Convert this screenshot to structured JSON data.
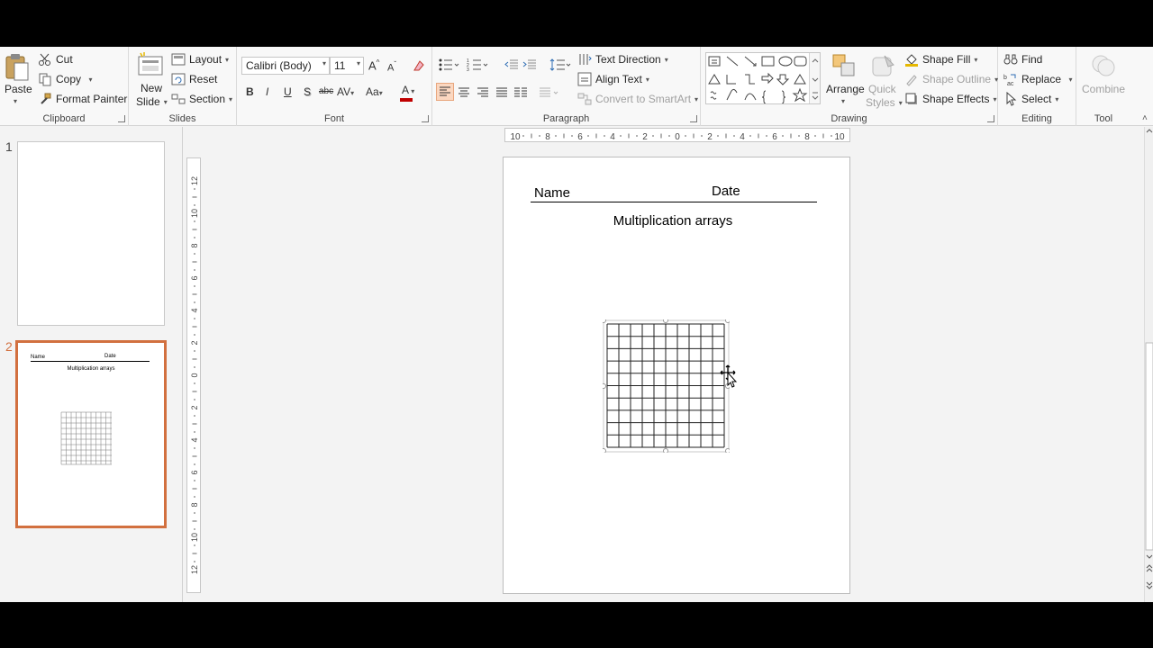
{
  "ribbon": {
    "clipboard": {
      "label": "Clipboard",
      "paste": "Paste",
      "cut": "Cut",
      "copy": "Copy",
      "format_painter": "Format Painter"
    },
    "slides": {
      "label": "Slides",
      "new_slide_line1": "New",
      "new_slide_line2": "Slide",
      "layout": "Layout",
      "reset": "Reset",
      "section": "Section"
    },
    "font": {
      "label": "Font",
      "family": "Calibri (Body)",
      "size": "11",
      "bold": "B",
      "italic": "I",
      "underline": "U",
      "shadow": "S",
      "strike": "abc",
      "spacing": "AV",
      "case": "Aa",
      "grow": "A",
      "shrink": "A",
      "color_letter": "A"
    },
    "paragraph": {
      "label": "Paragraph",
      "text_direction": "Text Direction",
      "align_text": "Align Text",
      "convert_smartart": "Convert to SmartArt"
    },
    "drawing": {
      "label": "Drawing",
      "arrange": "Arrange",
      "quick_styles_line1": "Quick",
      "quick_styles_line2": "Styles",
      "shape_fill": "Shape Fill",
      "shape_outline": "Shape Outline",
      "shape_effects": "Shape Effects"
    },
    "editing": {
      "label": "Editing",
      "find": "Find",
      "replace": "Replace",
      "select": "Select"
    },
    "tool": {
      "label": "Tool",
      "combine": "Combine"
    }
  },
  "thumbnails": [
    {
      "number": "1"
    },
    {
      "number": "2",
      "name": "Name",
      "date": "Date",
      "title": "Multiplication arrays"
    }
  ],
  "hruler_labels": [
    "10",
    "8",
    "6",
    "4",
    "2",
    "0",
    "2",
    "4",
    "6",
    "8",
    "10"
  ],
  "vruler_labels": [
    "12",
    "10",
    "8",
    "6",
    "4",
    "2",
    "0",
    "2",
    "4",
    "6",
    "8",
    "10",
    "12"
  ],
  "slide": {
    "name_label": "Name",
    "date_label": "Date",
    "title": "Multiplication arrays",
    "grid": {
      "rows": 10,
      "cols": 10
    }
  },
  "colors": {
    "accent": "#d2703f",
    "font_color_bar": "#c00000"
  }
}
